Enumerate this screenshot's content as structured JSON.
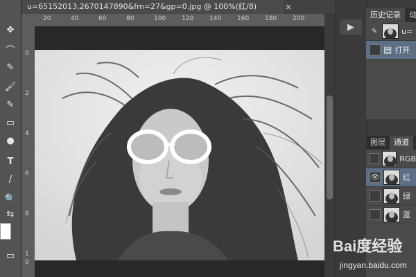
{
  "document": {
    "tab_title": "u=65152013,2670147890&fm=27&gp=0.jpg @ 100%(红/8)",
    "close_glyph": "×"
  },
  "rulers": {
    "horizontal": [
      "20",
      "40",
      "60",
      "80",
      "100",
      "120",
      "140",
      "160",
      "180",
      "200"
    ],
    "vertical": [
      "0",
      "2",
      "4",
      "6",
      "8",
      "1",
      "0"
    ]
  },
  "toolbox": {
    "tools": [
      {
        "name": "move-tool-icon",
        "glyph": "✥"
      },
      {
        "name": "lasso-tool-icon",
        "glyph": "⌒"
      },
      {
        "name": "eyedropper-tool-icon",
        "glyph": "✎"
      },
      {
        "name": "brush-tool-icon",
        "glyph": "🖌"
      },
      {
        "name": "history-brush-icon",
        "glyph": "✎"
      },
      {
        "name": "gradient-tool-icon",
        "glyph": "▭"
      },
      {
        "name": "blur-tool-icon",
        "glyph": "●"
      },
      {
        "name": "type-tool-icon",
        "glyph": "T"
      },
      {
        "name": "line-tool-icon",
        "glyph": "/"
      },
      {
        "name": "zoom-tool-icon",
        "glyph": "🔍"
      },
      {
        "name": "swap-colors-icon",
        "glyph": "⇆"
      }
    ],
    "screen_mode_glyph": "▭"
  },
  "dock": {
    "play_glyph": "▶"
  },
  "history_panel": {
    "tabs": [
      "历史记录",
      "动"
    ],
    "rows": [
      {
        "label": "u=",
        "type": "snapshot"
      },
      {
        "label": "打开",
        "type": "step"
      }
    ]
  },
  "channels_panel": {
    "tabs": [
      "图层",
      "通道"
    ],
    "rows": [
      {
        "label": "RGB",
        "visible": false,
        "selected": false
      },
      {
        "label": "红",
        "visible": true,
        "selected": true
      },
      {
        "label": "绿",
        "visible": false,
        "selected": false
      },
      {
        "label": "蓝",
        "visible": false,
        "selected": false
      }
    ]
  },
  "watermark": {
    "brand": "Bai度经验",
    "url": "jingyan.baidu.com"
  },
  "colors": {
    "selected_row": "#5d6f85",
    "panel_bg": "#4a4a4a",
    "canvas_bg": "#282828"
  }
}
